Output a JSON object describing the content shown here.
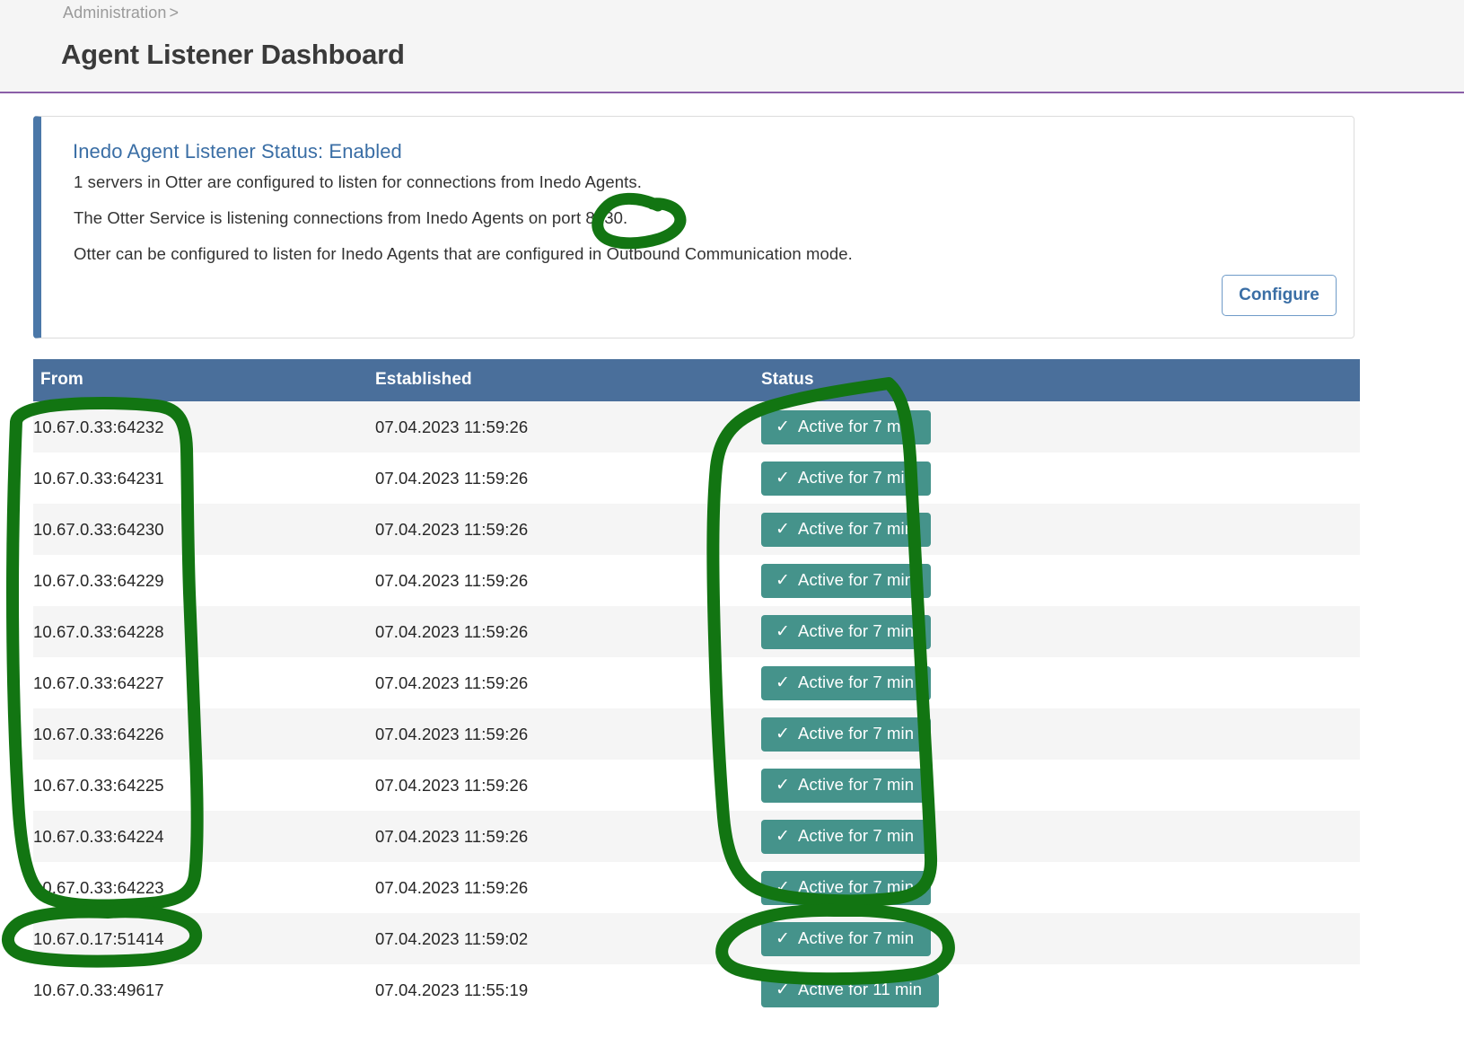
{
  "header": {
    "breadcrumb_label": "Administration",
    "breadcrumb_separator": ">",
    "title": "Agent Listener Dashboard"
  },
  "status_panel": {
    "title": "Inedo Agent Listener Status: Enabled",
    "line_1": "1 servers in Otter are configured to listen for connections from Inedo Agents.",
    "line_2": "The Otter Service is listening connections from Inedo Agents on port 8630.",
    "line_3": "Otter can be configured to listen for Inedo Agents that are configured in Outbound Communication mode.",
    "configure_label": "Configure",
    "accent_color": "#4a77a8",
    "title_color": "#3a6ea5"
  },
  "table": {
    "columns": [
      "From",
      "Established",
      "Status"
    ],
    "header_color": "#4a6f9b",
    "badge_color": "#45938b",
    "check_glyph": "✓",
    "rows": [
      {
        "from": "10.67.0.33:64232",
        "established": "07.04.2023 11:59:26",
        "status": "Active for 7 min"
      },
      {
        "from": "10.67.0.33:64231",
        "established": "07.04.2023 11:59:26",
        "status": "Active for 7 min"
      },
      {
        "from": "10.67.0.33:64230",
        "established": "07.04.2023 11:59:26",
        "status": "Active for 7 min"
      },
      {
        "from": "10.67.0.33:64229",
        "established": "07.04.2023 11:59:26",
        "status": "Active for 7 min"
      },
      {
        "from": "10.67.0.33:64228",
        "established": "07.04.2023 11:59:26",
        "status": "Active for 7 min"
      },
      {
        "from": "10.67.0.33:64227",
        "established": "07.04.2023 11:59:26",
        "status": "Active for 7 min"
      },
      {
        "from": "10.67.0.33:64226",
        "established": "07.04.2023 11:59:26",
        "status": "Active for 7 min"
      },
      {
        "from": "10.67.0.33:64225",
        "established": "07.04.2023 11:59:26",
        "status": "Active for 7 min"
      },
      {
        "from": "10.67.0.33:64224",
        "established": "07.04.2023 11:59:26",
        "status": "Active for 7 min"
      },
      {
        "from": "10.67.0.33:64223",
        "established": "07.04.2023 11:59:26",
        "status": "Active for 7 min"
      },
      {
        "from": "10.67.0.17:51414",
        "established": "07.04.2023 11:59:02",
        "status": "Active for 7 min"
      },
      {
        "from": "10.67.0.33:49617",
        "established": "07.04.2023 11:55:19",
        "status": "Active for 11 min"
      }
    ]
  },
  "annotations": {
    "ink_color": "#127512",
    "marks": [
      "circle-around-port-8630",
      "outline-around-from-column-rows-1-to-10",
      "oval-around-from-cell-10.67.0.17:51414",
      "outline-around-status-badges-rows-1-to-10",
      "oval-around-status-badge-row-11"
    ]
  }
}
